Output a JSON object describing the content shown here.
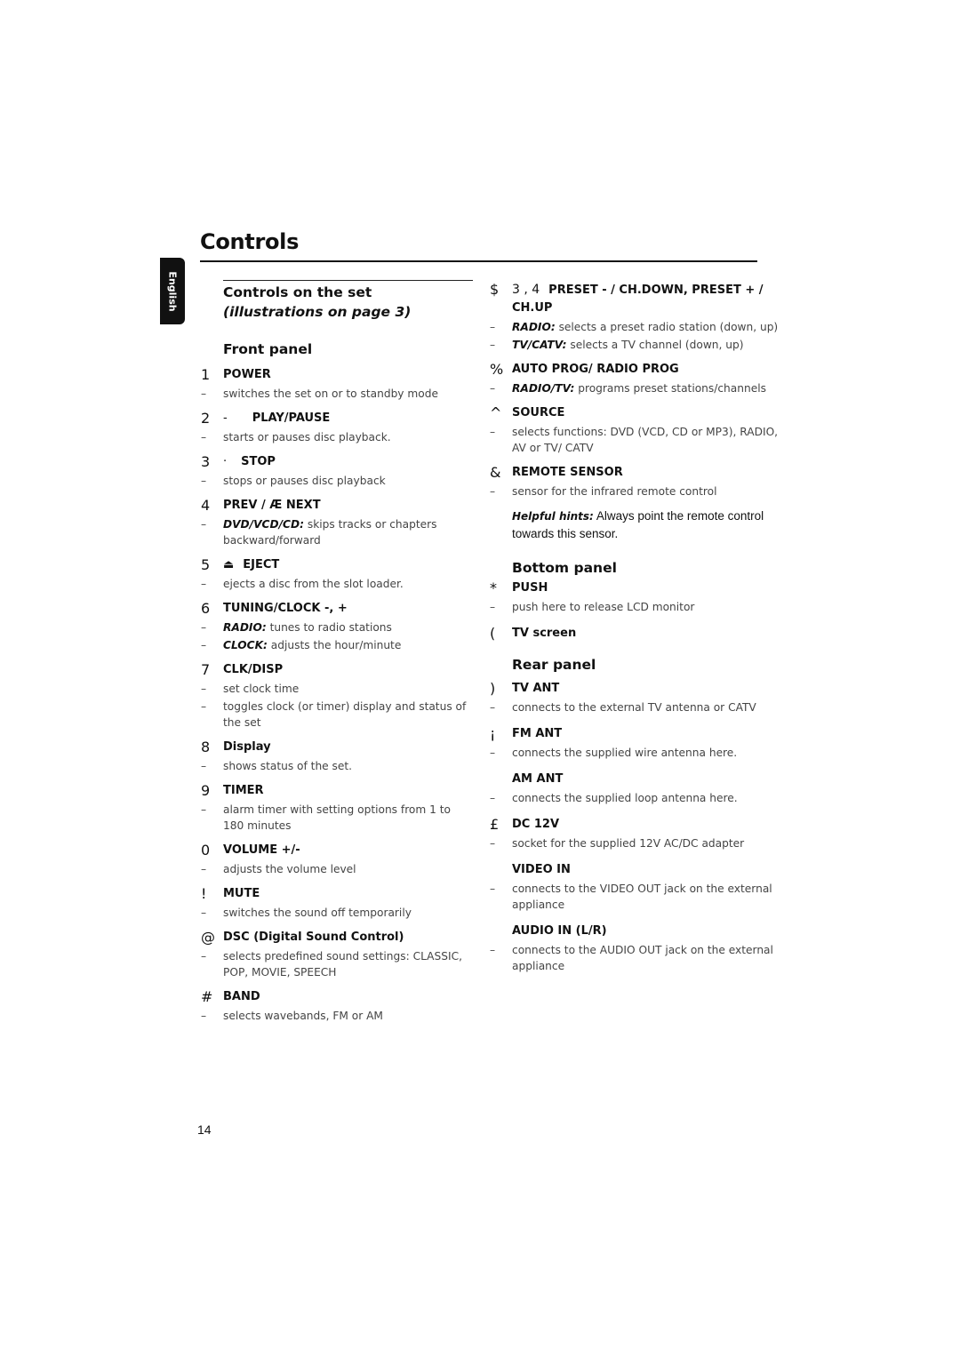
{
  "page": {
    "title": "Controls",
    "language_tab": "English",
    "page_number": "14"
  },
  "left": {
    "heading_main": "Controls on the set ",
    "heading_italic": "(illustrations on page 3)",
    "front_panel": "Front panel",
    "items": [
      {
        "num": "1",
        "label": "POWER",
        "desc": [
          {
            "text": "switches the set on or to standby mode"
          }
        ]
      },
      {
        "num": "2",
        "symbol": "-",
        "label": "PLAY/PAUSE",
        "desc": [
          {
            "text": "starts or pauses disc playback."
          }
        ]
      },
      {
        "num": "3",
        "symbol": "·",
        "label": "STOP",
        "desc": [
          {
            "text": "stops or pauses disc playback"
          }
        ]
      },
      {
        "num": "4",
        "label": "PREV     / Æ  NEXT",
        "desc": [
          {
            "bold": "DVD/VCD/CD:",
            "text": " skips tracks or chapters backward/forward"
          }
        ]
      },
      {
        "num": "5",
        "symbol": "⏏",
        "label": "EJECT",
        "desc": [
          {
            "text": "ejects a disc from the slot loader."
          }
        ]
      },
      {
        "num": "6",
        "label": "TUNING/CLOCK -, +",
        "desc": [
          {
            "bold": "RADIO:",
            "text": " tunes to radio stations"
          },
          {
            "bold": "CLOCK:",
            "text": " adjusts the hour/minute"
          }
        ]
      },
      {
        "num": "7",
        "label": "CLK/DISP",
        "desc": [
          {
            "text": "set clock time"
          },
          {
            "text": "toggles clock (or timer) display and status of the set"
          }
        ]
      },
      {
        "num": "8",
        "label": "Display",
        "desc": [
          {
            "text": "shows status of the set."
          }
        ]
      },
      {
        "num": "9",
        "label": "TIMER",
        "desc": [
          {
            "text": " alarm timer with setting options from 1 to 180 minutes"
          }
        ]
      },
      {
        "num": "0",
        "label": "VOLUME +/-",
        "desc": [
          {
            "text": " adjusts the volume level"
          }
        ]
      },
      {
        "num": "!",
        "label": "MUTE",
        "desc": [
          {
            "text": "switches the sound off temporarily"
          }
        ]
      },
      {
        "num": "@",
        "label": "DSC (Digital Sound Control)",
        "desc": [
          {
            "text": "selects predefined sound settings: CLASSIC, POP, MOVIE, SPEECH"
          }
        ]
      },
      {
        "num": "#",
        "label": "BAND",
        "desc": [
          {
            "text": "selects wavebands, FM or AM"
          }
        ]
      }
    ]
  },
  "right": {
    "items_top": [
      {
        "num": "$",
        "prefix": "3  , 4",
        "label": "PRESET - / CH.DOWN, PRESET + / CH.UP",
        "desc": [
          {
            "bold": "RADIO:",
            "text": " selects a preset radio station (down, up)"
          },
          {
            "bold": "TV/CATV:",
            "text": " selects a TV channel (down, up)"
          }
        ]
      },
      {
        "num": "%",
        "label": "AUTO PROG/ RADIO PROG",
        "desc": [
          {
            "bold": "RADIO/TV:",
            "text": " programs preset  stations/channels"
          }
        ]
      },
      {
        "num": "^",
        "label": "SOURCE",
        "desc": [
          {
            "text": "selects functions:  DVD (VCD, CD or MP3), RADIO, AV or  TV/ CATV"
          }
        ]
      },
      {
        "num": "&",
        "label": "REMOTE SENSOR",
        "desc": [
          {
            "text": "sensor for the infrared remote control"
          }
        ]
      }
    ],
    "hint_label": "Helpful hints:",
    "hint_text": "  Always point the remote control towards this sensor.",
    "bottom_panel": "Bottom panel",
    "items_bottom": [
      {
        "num": "*",
        "label": "PUSH",
        "desc": [
          {
            "text": "push here to release LCD monitor"
          }
        ]
      },
      {
        "num": "(",
        "label": "TV screen",
        "desc": []
      }
    ],
    "rear_panel": "Rear panel",
    "items_rear": [
      {
        "num": ")",
        "label": "TV ANT",
        "desc": [
          {
            "text": "connects to the external TV antenna or CATV"
          }
        ]
      },
      {
        "num": "¡",
        "label": "FM ANT",
        "desc": [
          {
            "text": "connects the supplied wire antenna here."
          }
        ]
      },
      {
        "num": "",
        "label": "AM ANT",
        "desc": [
          {
            "text": "connects the supplied loop antenna here."
          }
        ]
      },
      {
        "num": "£",
        "label": "DC 12V",
        "desc": [
          {
            "text": "socket for the supplied 12V AC/DC adapter"
          }
        ]
      },
      {
        "num": "",
        "label": "VIDEO IN",
        "desc": [
          {
            "text": "connects to the VIDEO OUT jack on the external appliance"
          }
        ]
      },
      {
        "num": "",
        "label": "AUDIO IN (L/R)",
        "desc": [
          {
            "text": "connects to the  AUDIO OUT jack on the external appliance"
          }
        ]
      }
    ]
  }
}
